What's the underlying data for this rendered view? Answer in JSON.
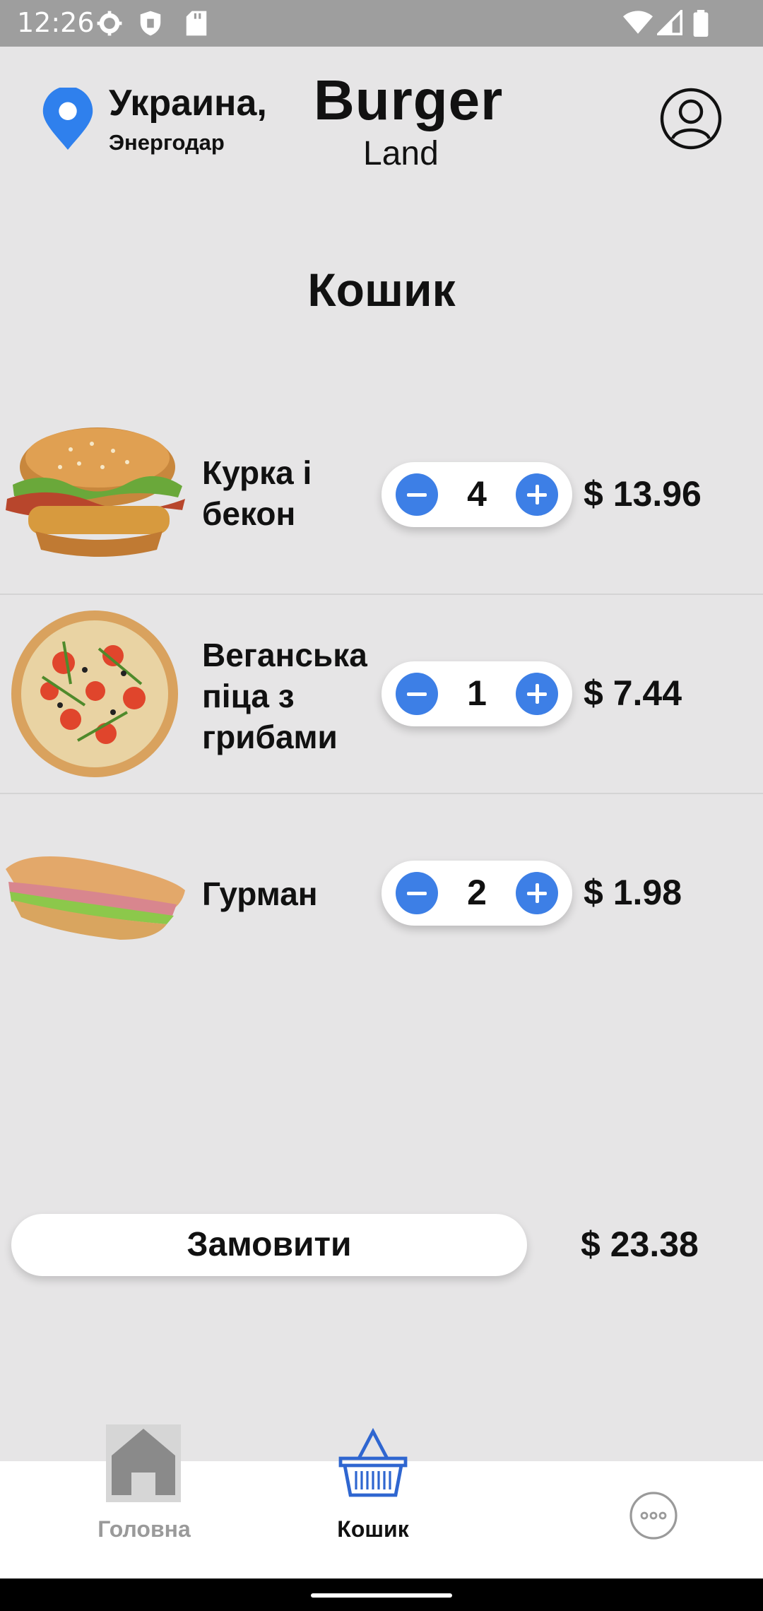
{
  "status_bar": {
    "time": "12:26"
  },
  "header": {
    "country": "Украина,",
    "city": "Энергодар",
    "brand_title": "Burger",
    "brand_subtitle": "Land"
  },
  "page": {
    "title": "Кошик"
  },
  "cart": {
    "items": [
      {
        "name_line1": "Курка і",
        "name_line2": "бекон",
        "name_line3": "",
        "quantity": "4",
        "price": "$ 13.96",
        "image": "chicken-bacon-burger"
      },
      {
        "name_line1": "Веганська",
        "name_line2": "піца з",
        "name_line3": "грибами",
        "quantity": "1",
        "price": "$ 7.44",
        "image": "vegan-mushroom-pizza"
      },
      {
        "name_line1": "Гурман",
        "name_line2": "",
        "name_line3": "",
        "quantity": "2",
        "price": "$ 1.98",
        "image": "gourmet-sub-sandwich"
      }
    ]
  },
  "order": {
    "button_label": "Замовити",
    "total": "$ 23.38"
  },
  "nav": {
    "home_label": "Головна",
    "cart_label": "Кошик"
  },
  "colors": {
    "background": "#e6e5e6",
    "accent": "#3d7fe6",
    "nav_active_icon": "#2f66d0",
    "nav_inactive": "#9a9a9a"
  }
}
